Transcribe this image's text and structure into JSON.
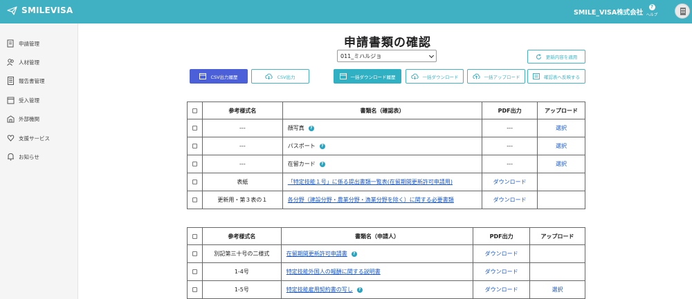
{
  "header": {
    "brand": "SMILEVISA",
    "company": "SMILE_VISA株式会社",
    "help_label": "ヘルプ"
  },
  "sidebar": {
    "items": [
      {
        "label": "申請管理",
        "icon": "document-edit-icon"
      },
      {
        "label": "人材管理",
        "icon": "people-icon"
      },
      {
        "label": "報告書管理",
        "icon": "report-icon"
      },
      {
        "label": "受入管理",
        "icon": "calendar-icon"
      },
      {
        "label": "外部機関",
        "icon": "building-icon"
      },
      {
        "label": "支援サービス",
        "icon": "heart-hand-icon"
      },
      {
        "label": "お知らせ",
        "icon": "bell-icon"
      }
    ]
  },
  "main": {
    "title": "申請書類の確認",
    "selected_person": "011_ミハルジョ",
    "buttons": {
      "apply_update": "更新内容を適用",
      "csv_history": "CSV出力履歴",
      "csv_output": "CSV出力",
      "bulk_download_history": "一括ダウンロード履歴",
      "bulk_download": "一括ダウンロード",
      "bulk_upload": "一括アップロード",
      "reflect_confirmation": "確認表へ反映する"
    }
  },
  "table1": {
    "headers": [
      "参考様式名",
      "書類名（確認表）",
      "PDF出力",
      "アップロード"
    ],
    "rows": [
      {
        "ref": "---",
        "name": "顔写真",
        "help": true,
        "link": false,
        "pdf": "---",
        "upload": "選択"
      },
      {
        "ref": "---",
        "name": "パスポート",
        "help": true,
        "link": false,
        "pdf": "---",
        "upload": "選択"
      },
      {
        "ref": "---",
        "name": "在留カード",
        "help": true,
        "link": false,
        "pdf": "---",
        "upload": "選択"
      },
      {
        "ref": "表紙",
        "name": "「特定技能１号」に係る提出書類一覧表(在留期間更新許可申請用)",
        "help": false,
        "link": true,
        "pdf": "ダウンロード",
        "upload": ""
      },
      {
        "ref": "更新用・第３表の１",
        "name": "各分野（建設分野・農業分野・漁業分野を除く）に関する必要書類",
        "help": false,
        "link": true,
        "pdf": "ダウンロード",
        "upload": ""
      }
    ]
  },
  "table2": {
    "headers": [
      "参考様式名",
      "書類名（申請人）",
      "PDF出力",
      "アップロード"
    ],
    "rows": [
      {
        "ref": "別記第三十号の二様式",
        "name": "在留期間更新許可申請書",
        "help": true,
        "link": true,
        "pdf": "ダウンロード",
        "upload": ""
      },
      {
        "ref": "1-4号",
        "name": "特定技能外国人の報酬に関する説明書",
        "help": false,
        "link": true,
        "pdf": "ダウンロード",
        "upload": ""
      },
      {
        "ref": "1-5号",
        "name": "特定技能雇用契約書の写し",
        "help": true,
        "link": true,
        "pdf": "ダウンロード",
        "upload": "選択"
      }
    ]
  },
  "colors": {
    "header_bg": "#40b0c3",
    "primary_button": "#4b5fd8",
    "teal_button": "#2fb0c3",
    "link": "#1a56c8"
  }
}
